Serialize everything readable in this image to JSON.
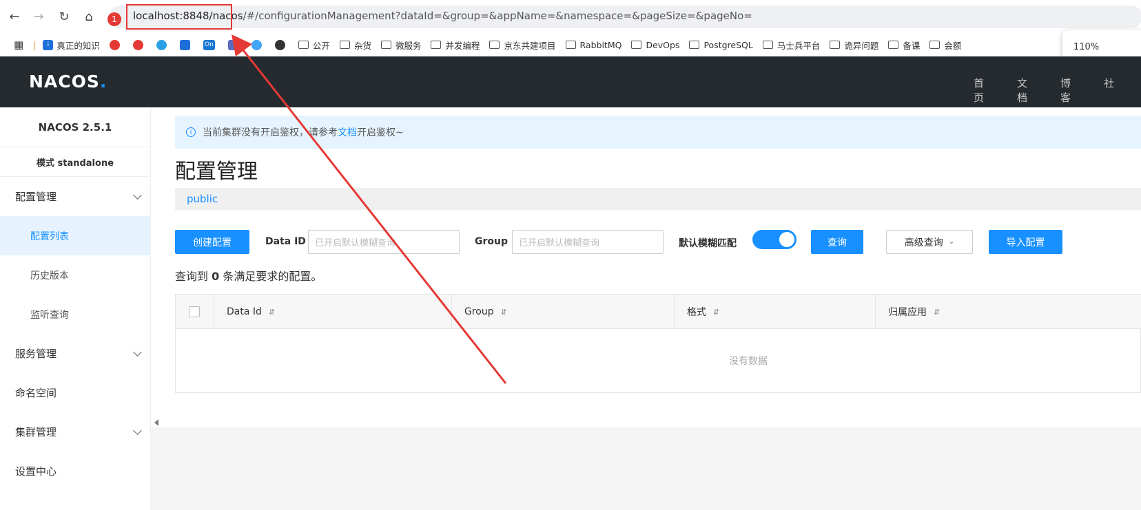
{
  "browser": {
    "url_host": "localhost:8848/nacos",
    "url_rest": "/#/configurationManagement?dataId=&group=&appName=&namespace=&pageSize=&pageNo=",
    "badge": "1",
    "zoom": "110%"
  },
  "bookmarks": [
    {
      "label": "真正的知识",
      "kind": "app"
    },
    {
      "label": "",
      "kind": "app"
    },
    {
      "label": "",
      "kind": "app"
    },
    {
      "label": "",
      "kind": "app"
    },
    {
      "label": "",
      "kind": "app"
    },
    {
      "label": "On",
      "kind": "app"
    },
    {
      "label": "",
      "kind": "app"
    },
    {
      "label": "",
      "kind": "app"
    },
    {
      "label": "",
      "kind": "app"
    },
    {
      "label": "公开",
      "kind": "folder"
    },
    {
      "label": "杂货",
      "kind": "folder"
    },
    {
      "label": "微服务",
      "kind": "folder"
    },
    {
      "label": "并发编程",
      "kind": "folder"
    },
    {
      "label": "京东共建项目",
      "kind": "folder"
    },
    {
      "label": "RabbitMQ",
      "kind": "folder"
    },
    {
      "label": "DevOps",
      "kind": "folder"
    },
    {
      "label": "PostgreSQL",
      "kind": "folder"
    },
    {
      "label": "马士兵平台",
      "kind": "folder"
    },
    {
      "label": "诡异问题",
      "kind": "folder"
    },
    {
      "label": "备课",
      "kind": "folder"
    },
    {
      "label": "会额",
      "kind": "folder"
    }
  ],
  "header": {
    "logo": "NACOS",
    "logo_dot": ".",
    "links": [
      "首页",
      "文档",
      "博客",
      "社"
    ]
  },
  "sidebar": {
    "version": "NACOS 2.5.1",
    "mode": "模式 standalone",
    "items": [
      {
        "label": "配置管理"
      },
      {
        "label": "配置列表"
      },
      {
        "label": "历史版本"
      },
      {
        "label": "监听查询"
      },
      {
        "label": "服务管理"
      },
      {
        "label": "命名空间"
      },
      {
        "label": "集群管理"
      },
      {
        "label": "设置中心"
      }
    ]
  },
  "notice": {
    "before": "当前集群没有开启鉴权，请参考",
    "link": "文档",
    "after": "开启鉴权~"
  },
  "main": {
    "title": "配置管理",
    "namespace": "public",
    "create_btn": "创建配置",
    "data_id_label": "Data ID",
    "data_id_placeholder": "已开启默认模糊查询",
    "group_label": "Group",
    "group_placeholder": "已开启默认模糊查询",
    "fuzzy_label": "默认模糊匹配",
    "query_btn": "查询",
    "advanced_btn": "高级查询",
    "import_btn": "导入配置",
    "count_prefix": "查询到 ",
    "count": "0",
    "count_suffix": " 条满足要求的配置。"
  },
  "table": {
    "columns": [
      "Data Id",
      "Group",
      "格式",
      "归属应用"
    ],
    "sort_icon": "⇵",
    "empty": "没有数据"
  }
}
